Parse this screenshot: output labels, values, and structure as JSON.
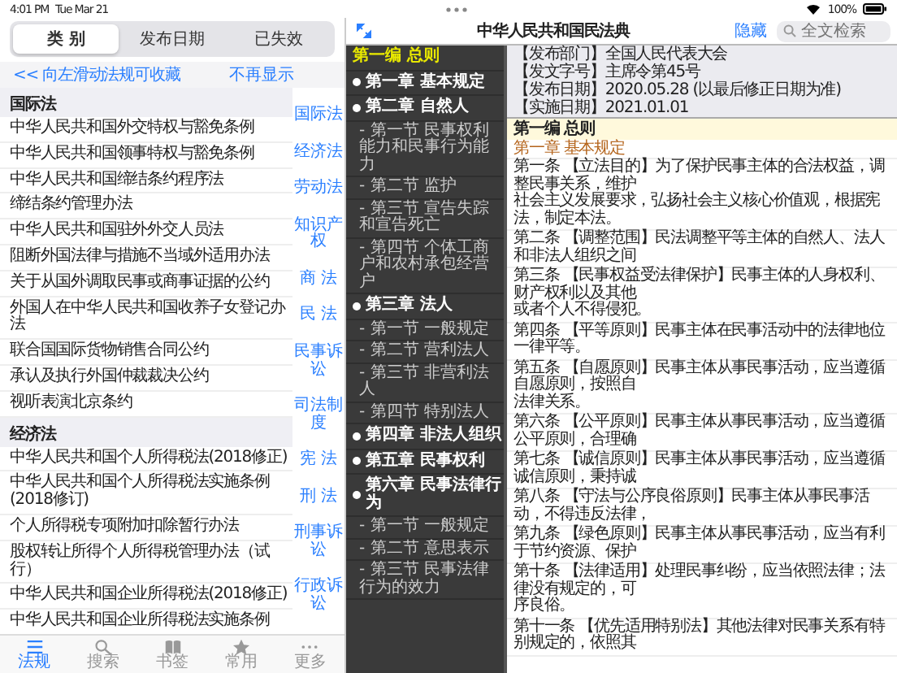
{
  "status_bar": {
    "time": "4:01 PM",
    "date": "Tue Mar 21",
    "battery": "100%"
  },
  "segments": [
    {
      "label": "类 别",
      "selected": true
    },
    {
      "label": "发布日期",
      "selected": false
    },
    {
      "label": "已失效",
      "selected": false
    }
  ],
  "hint": {
    "text": "<< 向左滑动法规可收藏",
    "dismiss": "不再显示"
  },
  "law_sections": [
    {
      "title": "国际法",
      "items": [
        "中华人民共和国外交特权与豁免条例",
        "中华人民共和国领事特权与豁免条例",
        "中华人民共和国缔结条约程序法",
        "缔结条约管理办法",
        "中华人民共和国驻外外交人员法",
        "阻断外国法律与措施不当域外适用办法",
        "关于从国外调取民事或商事证据的公约",
        "外国人在中华人民共和国收养子女登记办法",
        "联合国国际货物销售合同公约",
        "承认及执行外国仲裁裁决公约",
        "视听表演北京条约"
      ]
    },
    {
      "title": "经济法",
      "items": [
        "中华人民共和国个人所得税法(2018修正)",
        "中华人民共和国个人所得税法实施条例(2018修订)",
        "个人所得税专项附加扣除暂行办法",
        "股权转让所得个人所得税管理办法（试行）",
        "中华人民共和国企业所得税法(2018修正)",
        "中华人民共和国企业所得税法实施条例"
      ]
    }
  ],
  "category_index": [
    "国际法",
    "经济法",
    "劳动法",
    "知识产权",
    "商 法",
    "民 法",
    "民事诉讼",
    "司法制度",
    "宪 法",
    "刑 法",
    "刑事诉讼",
    "行政诉讼"
  ],
  "tab_bar": [
    {
      "label": "法规",
      "selected": true
    },
    {
      "label": "搜索",
      "selected": false
    },
    {
      "label": "书签",
      "selected": false
    },
    {
      "label": "常用",
      "selected": false
    },
    {
      "label": "更多",
      "selected": false
    }
  ],
  "header": {
    "title": "中华人民共和国民法典",
    "hide": "隐藏",
    "search_placeholder": "全文检索"
  },
  "toc": {
    "part": {
      "label": "第一编 总则",
      "selected": true
    },
    "chapters": [
      {
        "label": "第一章 基本规定"
      },
      {
        "label": "第二章 自然人",
        "children": [
          "- 第一节 民事权利能力和民事行为能力",
          "- 第二节 监护",
          "- 第三节 宣告失踪和宣告死亡",
          "- 第四节 个体工商户和农村承包经营户"
        ]
      },
      {
        "label": "第三章 法人",
        "children": [
          "- 第一节 一般规定",
          "- 第二节 营利法人",
          "- 第三节 非营利法人",
          "- 第四节 特别法人"
        ]
      },
      {
        "label": "第四章 非法人组织"
      },
      {
        "label": "第五章 民事权利"
      },
      {
        "label": "第六章 民事法律行为",
        "children": [
          "- 第一节 一般规定",
          "- 第二节 意思表示",
          "- 第三节 民事法律行为的效力"
        ]
      }
    ]
  },
  "document": {
    "meta": [
      "【发布部门】全国人民代表大会",
      "【发文字号】主席令第45号",
      "【发布日期】2020.05.28 (以最后修正日期为准)",
      "【实施日期】2021.01.01"
    ],
    "part_title": "第一编 总则",
    "chapter_title": "第一章 基本规定",
    "articles": [
      {
        "lines": [
          "第一条 【立法目的】为了保护民事主体的合法权益，调整民事关系，维护",
          "社会主义发展要求，弘扬社会主义核心价值观，根据宪法，制定本法。"
        ]
      },
      {
        "lines": [
          "第二条 【调整范围】民法调整平等主体的自然人、法人和非法人组织之间"
        ]
      },
      {
        "lines": [
          "第三条 【民事权益受法律保护】民事主体的人身权利、财产权利以及其他",
          "或者个人不得侵犯。"
        ]
      },
      {
        "lines": [
          "第四条 【平等原则】民事主体在民事活动中的法律地位一律平等。"
        ]
      },
      {
        "lines": [
          "第五条 【自愿原则】民事主体从事民事活动，应当遵循自愿原则，按照自",
          "法律关系。"
        ]
      },
      {
        "lines": [
          "第六条 【公平原则】民事主体从事民事活动，应当遵循公平原则，合理确"
        ]
      },
      {
        "lines": [
          "第七条 【诚信原则】民事主体从事民事活动，应当遵循诚信原则，秉持诚"
        ]
      },
      {
        "lines": [
          "第八条 【守法与公序良俗原则】民事主体从事民事活动，不得违反法律，"
        ]
      },
      {
        "lines": [
          "第九条 【绿色原则】民事主体从事民事活动，应当有利于节约资源、保护"
        ]
      },
      {
        "lines": [
          "第十条 【法律适用】处理民事纠纷，应当依照法律；法律没有规定的，可",
          "序良俗。"
        ]
      },
      {
        "lines": [
          "第十一条 【优先适用特别法】其他法律对民事关系有特别规定的，依照其"
        ]
      }
    ]
  }
}
